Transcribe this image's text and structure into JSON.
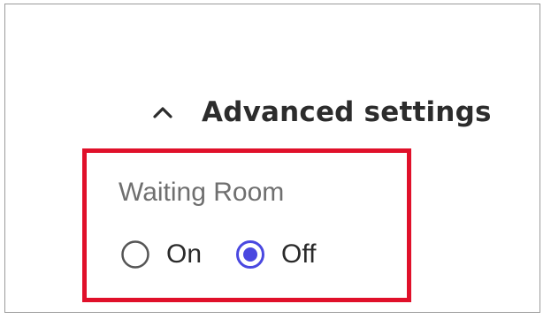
{
  "advanced_settings": {
    "label": "Advanced settings",
    "icon": "chevron-up-icon",
    "expanded": true
  },
  "waiting_room": {
    "title": "Waiting Room",
    "options": [
      {
        "label": "On",
        "selected": false
      },
      {
        "label": "Off",
        "selected": true
      }
    ]
  },
  "colors": {
    "highlight_border": "#e0102a",
    "radio_selected": "#4a48e0",
    "radio_unselected": "#555555",
    "title_text": "#6f6f6f"
  }
}
